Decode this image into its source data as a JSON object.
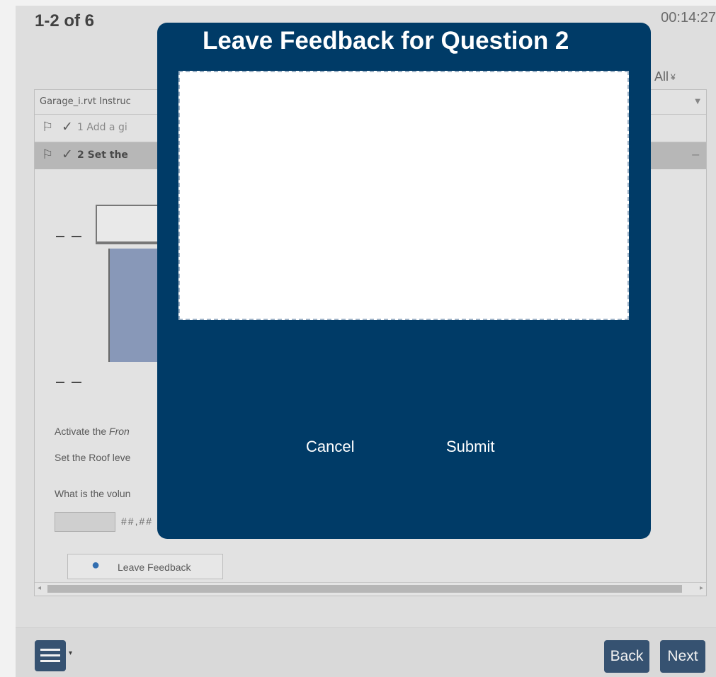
{
  "header": {
    "counter": "1-2 of 6",
    "timer": "00:14:27",
    "expand_all": "d All"
  },
  "panel": {
    "file_label": "Garage_i.rvt Instruc",
    "questions": [
      {
        "number": "1",
        "text": "1 Add a gi"
      },
      {
        "number": "2",
        "text": "2 Set the"
      }
    ],
    "instructions": {
      "line1_prefix": "Activate the ",
      "line1_italic": "Fron",
      "line2": "Set the Roof leve",
      "line3": "What is the volun"
    },
    "answer_format": "##,##",
    "feedback_button": "Leave Feedback"
  },
  "modal": {
    "title": "Leave Feedback for Question 2",
    "textarea_value": "",
    "cancel": "Cancel",
    "submit": "Submit"
  },
  "footer": {
    "back": "Back",
    "next": "Next"
  },
  "icons": {
    "flag": "flag-icon",
    "check": "checkmark-icon",
    "bubble": "speech-bubble-icon",
    "menu": "hamburger-menu-icon"
  },
  "colors": {
    "modal_bg": "#003b67",
    "nav_button": "#2e4d70",
    "question_highlight": "#bebebe",
    "wall_fill": "#8a9bbf"
  }
}
